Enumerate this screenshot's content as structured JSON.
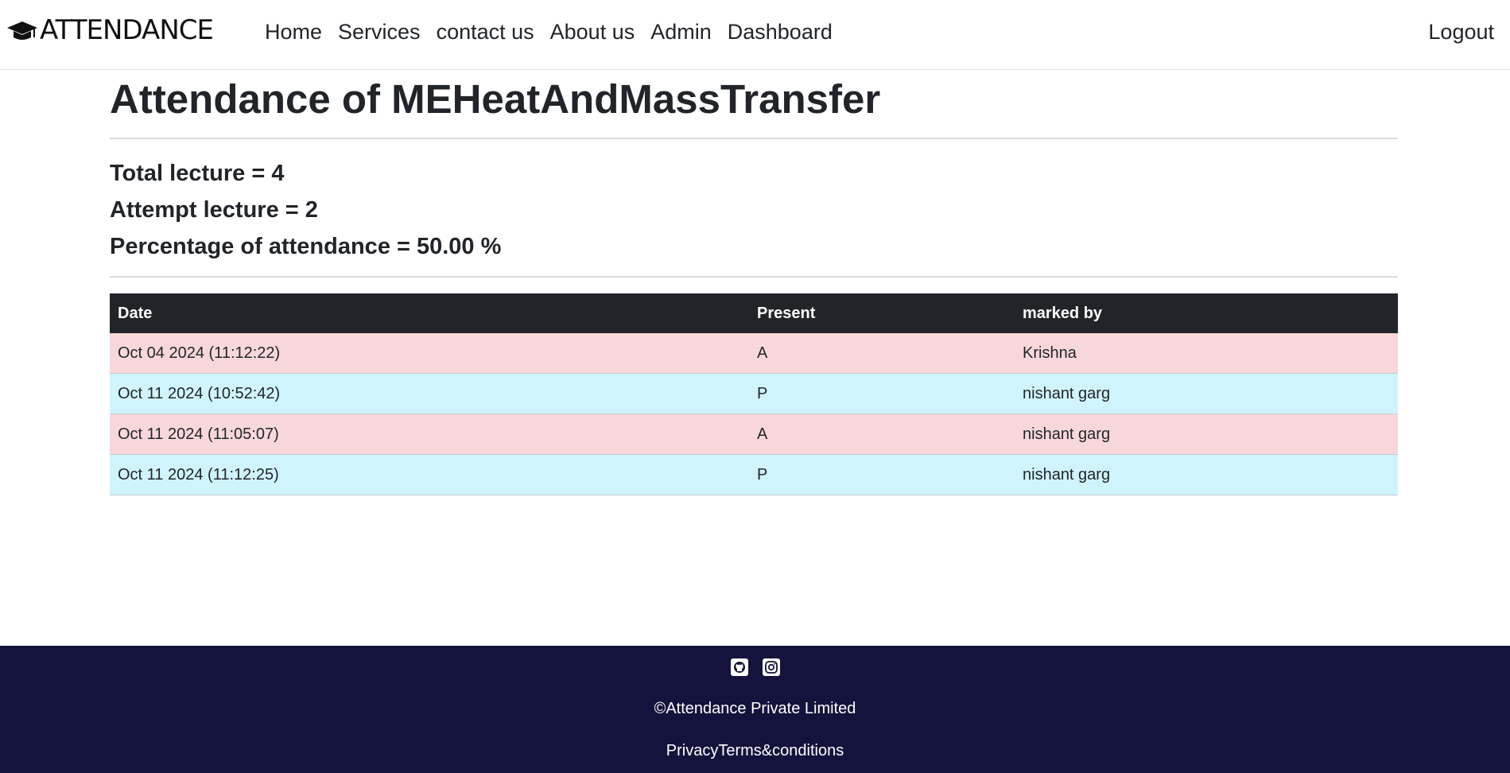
{
  "brand": {
    "name": "ATTENDANCE",
    "icon": "graduation-cap-icon"
  },
  "nav": {
    "items": [
      "Home",
      "Services",
      "contact us",
      "About us",
      "Admin",
      "Dashboard"
    ],
    "logout": "Logout"
  },
  "page": {
    "title": "Attendance of MEHeatAndMassTransfer",
    "total_lecture": "Total lecture = 4",
    "attempt_lecture": "Attempt lecture = 2",
    "percentage": "Percentage of attendance = 50.00 %"
  },
  "table": {
    "headers": [
      "Date",
      "Present",
      "marked by"
    ],
    "rows": [
      {
        "date": "Oct 04 2024 (11:12:22)",
        "present": "A",
        "marked_by": "Krishna",
        "status": "absent"
      },
      {
        "date": "Oct 11 2024 (10:52:42)",
        "present": "P",
        "marked_by": "nishant garg",
        "status": "present"
      },
      {
        "date": "Oct 11 2024 (11:05:07)",
        "present": "A",
        "marked_by": "nishant garg",
        "status": "absent"
      },
      {
        "date": "Oct 11 2024 (11:12:25)",
        "present": "P",
        "marked_by": "nishant garg",
        "status": "present"
      }
    ],
    "colors": {
      "header_bg": "#212529",
      "absent_bg": "#f8d7da",
      "present_bg": "#cff4fc"
    }
  },
  "footer": {
    "icons": [
      "github-icon",
      "instagram-icon"
    ],
    "copyright": "©Attendance Private Limited",
    "privacy": "Privacy",
    "terms": "Terms&conditions",
    "bg": "#13133d"
  }
}
